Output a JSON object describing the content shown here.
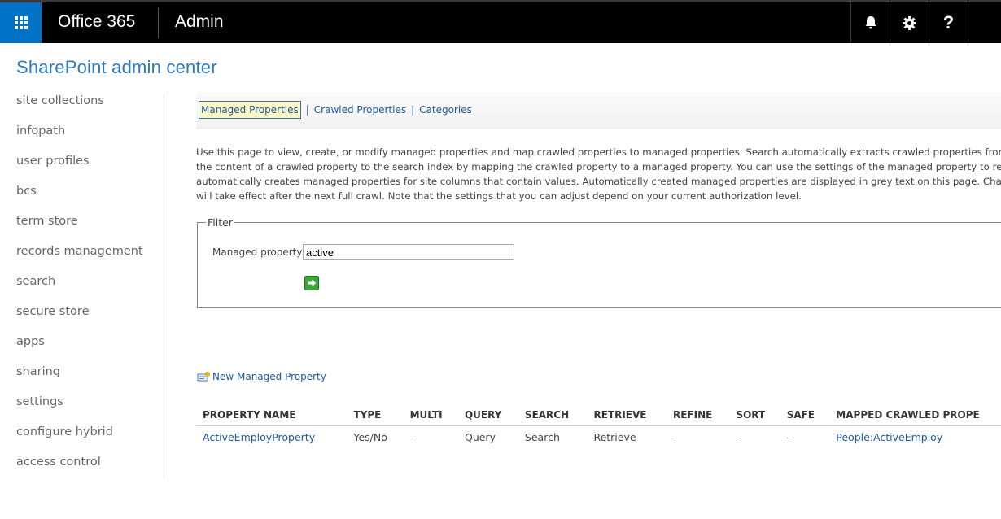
{
  "header": {
    "brand": "Office 365",
    "app": "Admin",
    "help_glyph": "?",
    "icons": [
      "waffle-icon",
      "bell-icon",
      "gear-icon",
      "help-icon"
    ],
    "colors": {
      "waffle_bg": "#0072c6",
      "bar_bg": "#000000"
    }
  },
  "page_title": "SharePoint admin center",
  "nav": {
    "items": [
      "site collections",
      "infopath",
      "user profiles",
      "bcs",
      "term store",
      "records management",
      "search",
      "secure store",
      "apps",
      "sharing",
      "settings",
      "configure hybrid",
      "access control"
    ]
  },
  "tabs": {
    "managed": "Managed Properties",
    "sep1": "|",
    "crawled": "Crawled Properties",
    "sep2": "|",
    "categories": "Categories"
  },
  "description": {
    "line1": "Use this page to view, create, or modify managed properties and map crawled properties to managed properties. Search automatically extracts crawled properties from crawled",
    "line2": "the content of a crawled property to the search index by mapping the crawled property to a managed property. You can use the settings of the managed property to restrict se",
    "line3": "automatically creates managed properties for site columns that contain values. Automatically created managed properties are displayed in grey text on this page. Changes to a",
    "line4": "will take effect after the next full crawl. Note that the settings that you can adjust depend on your current authorization level."
  },
  "filter": {
    "legend": "Filter",
    "label": "Managed property",
    "value": "active"
  },
  "new_property_label": "New Managed Property",
  "table": {
    "headers": [
      "PROPERTY NAME",
      "TYPE",
      "MULTI",
      "QUERY",
      "SEARCH",
      "RETRIEVE",
      "REFINE",
      "SORT",
      "SAFE",
      "MAPPED CRAWLED PROPE"
    ],
    "rows": [
      [
        "ActiveEmployProperty",
        "Yes/No",
        "-",
        "Query",
        "Search",
        "Retrieve",
        "-",
        "-",
        "-",
        "People:ActiveEmploy"
      ]
    ]
  }
}
